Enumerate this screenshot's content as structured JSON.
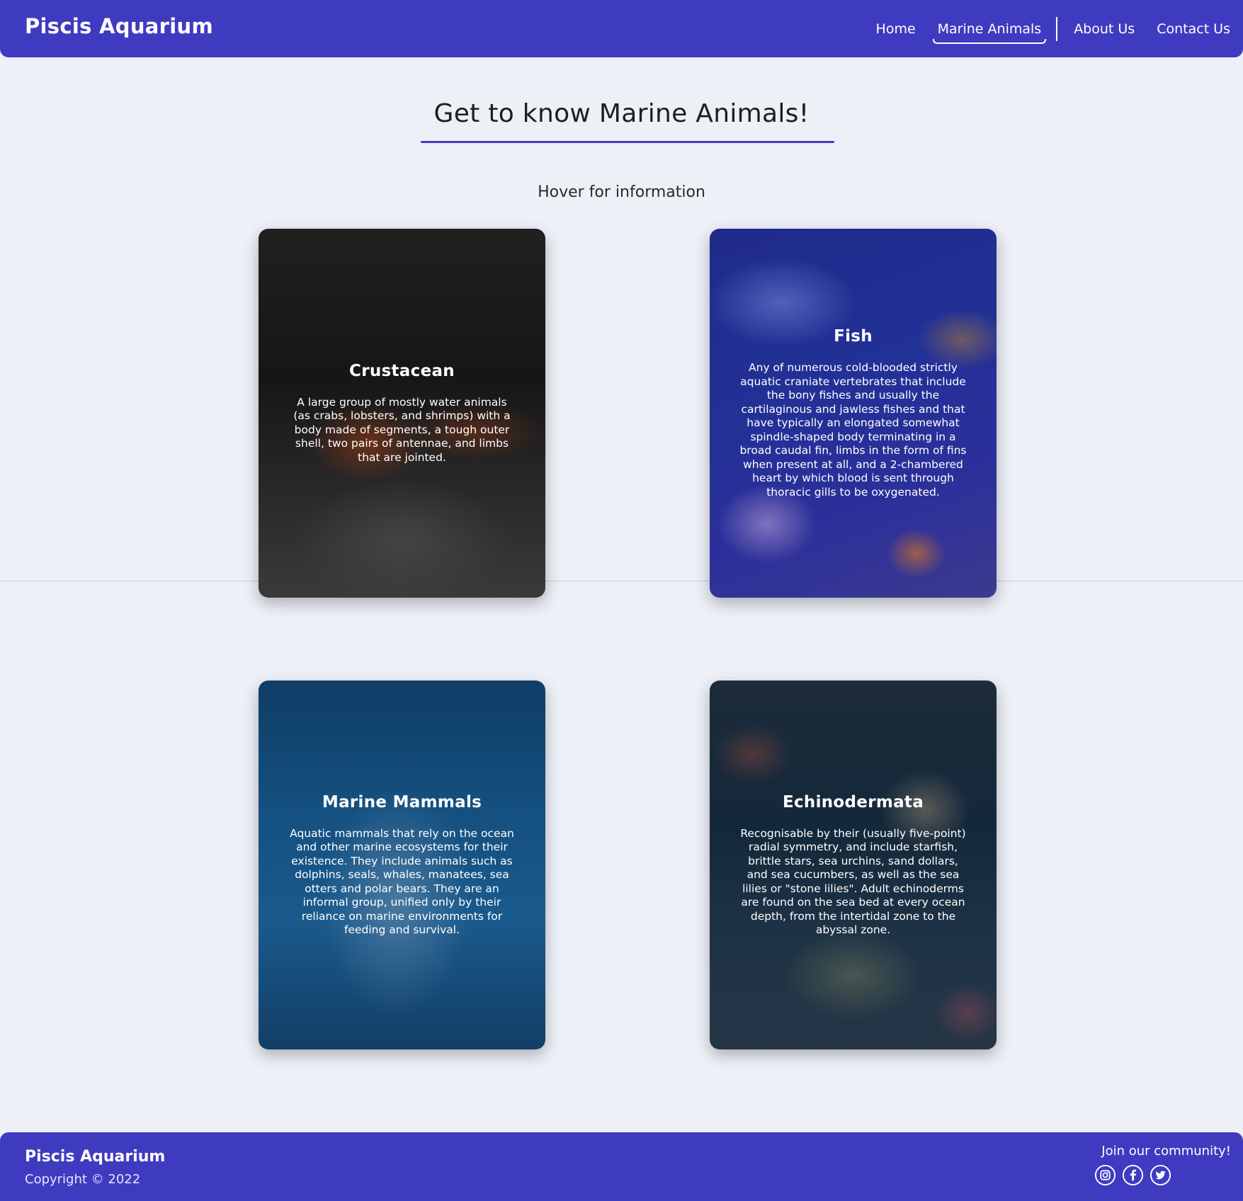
{
  "header": {
    "brand": "Piscis Aquarium",
    "nav": [
      {
        "label": "Home"
      },
      {
        "label": "Marine Animals",
        "active": true
      },
      {
        "label": "About Us"
      },
      {
        "label": "Contact Us"
      }
    ]
  },
  "main": {
    "title": "Get to know Marine Animals!",
    "subtitle": "Hover for information",
    "cards": [
      {
        "title": "Crustacean",
        "text": "A large group of mostly water animals (as crabs, lobsters, and shrimps) with a body made of segments, a tough outer shell, two pairs of antennae, and limbs that are jointed."
      },
      {
        "title": "Fish",
        "text": "Any of numerous cold-blooded strictly aquatic craniate vertebrates that include the bony fishes and usually the cartilaginous and jawless fishes and that have typically an elongated somewhat spindle-shaped body terminating in a broad caudal fin, limbs in the form of fins when present at all, and a 2-chambered heart by which blood is sent through thoracic gills to be oxygenated."
      },
      {
        "title": "Marine Mammals",
        "text": "Aquatic mammals that rely on the ocean and other marine ecosystems for their existence. They include animals such as dolphins, seals, whales, manatees, sea otters and polar bears. They are an informal group, unified only by their reliance on marine environments for feeding and survival."
      },
      {
        "title": "Echinodermata",
        "text": "Recognisable by their (usually five-point) radial symmetry, and include starfish, brittle stars, sea urchins, sand dollars, and sea cucumbers, as well as the sea lilies or \"stone lilies\". Adult echinoderms are found on the sea bed at every ocean depth, from the intertidal zone to the abyssal zone."
      }
    ]
  },
  "footer": {
    "brand": "Piscis Aquarium",
    "copyright": "Copyright © 2022",
    "join": "Join our community!",
    "socials": [
      "instagram-icon",
      "facebook-icon",
      "twitter-icon"
    ]
  },
  "colors": {
    "primary": "#3f3bc1",
    "background": "#edf0f7"
  }
}
